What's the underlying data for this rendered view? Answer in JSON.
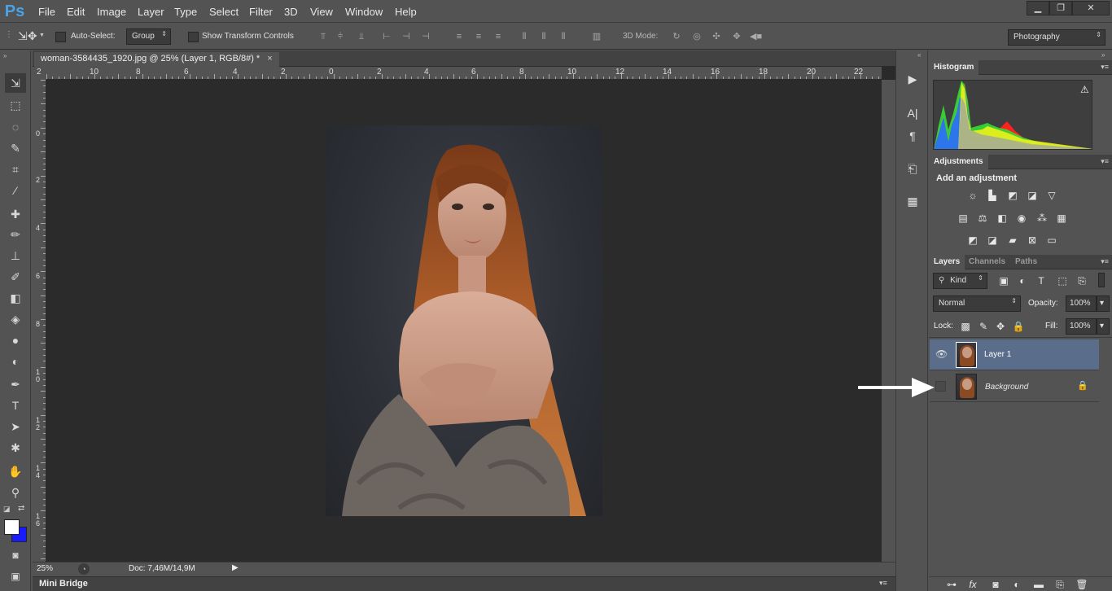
{
  "app": {
    "logo": "Ps"
  },
  "menu": [
    "File",
    "Edit",
    "Image",
    "Layer",
    "Type",
    "Select",
    "Filter",
    "3D",
    "View",
    "Window",
    "Help"
  ],
  "window_controls": {
    "minimize": "▁",
    "restore": "❐",
    "close": "✕"
  },
  "options": {
    "auto_select_label": "Auto-Select:",
    "auto_select_value": "Group",
    "show_transform_label": "Show Transform Controls",
    "mode_3d_label": "3D Mode:",
    "workspace": "Photography"
  },
  "document": {
    "tab_title": "woman-3584435_1920.jpg @ 25% (Layer 1, RGB/8#) *",
    "tab_close": "×",
    "hruler_ticks": [
      "2",
      "10",
      "8",
      "6",
      "4",
      "2",
      "0",
      "2",
      "4",
      "6",
      "8",
      "10",
      "12",
      "14",
      "16",
      "18",
      "20",
      "22"
    ],
    "vruler_ticks": [
      "0",
      "2",
      "4",
      "6",
      "8",
      "1 0",
      "1 2",
      "1 4",
      "1 6"
    ],
    "zoom": "25%",
    "doc_info": "Doc: 7,46M/14,9M",
    "mini_bridge": "Mini Bridge"
  },
  "panels": {
    "histogram": {
      "title": "Histogram",
      "warning_icon": "⚠"
    },
    "adjustments": {
      "title": "Adjustments",
      "heading": "Add an adjustment"
    },
    "layers": {
      "tabs": [
        "Layers",
        "Channels",
        "Paths"
      ],
      "filter_kind": "Kind",
      "blend_mode": "Normal",
      "opacity_label": "Opacity:",
      "opacity_value": "100%",
      "lock_label": "Lock:",
      "fill_label": "Fill:",
      "fill_value": "100%",
      "items": [
        {
          "name": "Layer 1",
          "visible": true,
          "selected": true
        },
        {
          "name": "Background",
          "visible": false,
          "locked": true
        }
      ]
    }
  },
  "colors": {
    "foreground": "#ffffff",
    "background": "#1a1aff",
    "selected_layer": "#5a6d8a",
    "histogram_red": "#ff2020",
    "histogram_green": "#33dd33",
    "histogram_blue": "#2a6cff",
    "histogram_yellow": "#f5f51a"
  }
}
